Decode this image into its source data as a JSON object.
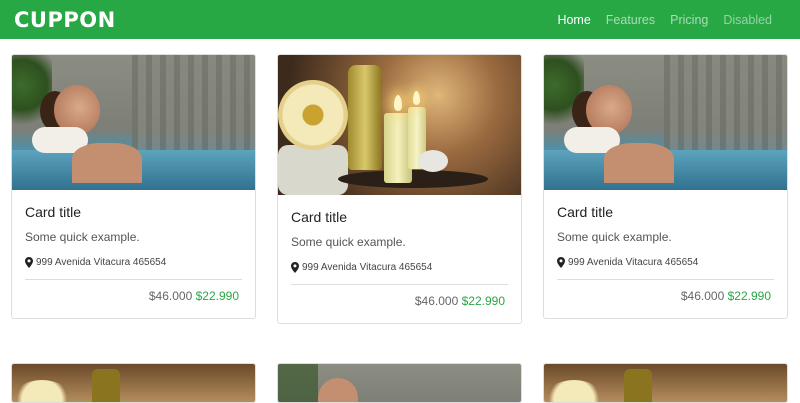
{
  "navbar": {
    "brand": "CUPPON",
    "links": [
      {
        "label": "Home",
        "state": "active"
      },
      {
        "label": "Features",
        "state": "normal"
      },
      {
        "label": "Pricing",
        "state": "normal"
      },
      {
        "label": "Disabled",
        "state": "disabled"
      }
    ]
  },
  "cards": [
    {
      "title": "Card title",
      "text": "Some quick example.",
      "address": "999 Avenida Vitacura 465654",
      "old_price": "$46.000",
      "new_price": "$22.990",
      "image": "spa-pool-woman"
    },
    {
      "title": "Card title",
      "text": "Some quick example.",
      "address": "999 Avenida Vitacura 465654",
      "old_price": "$46.000",
      "new_price": "$22.990",
      "image": "spa-candles"
    },
    {
      "title": "Card title",
      "text": "Some quick example.",
      "address": "999 Avenida Vitacura 465654",
      "old_price": "$46.000",
      "new_price": "$22.990",
      "image": "spa-pool-woman"
    }
  ],
  "row2_images": [
    "spa-candles",
    "spa-pool-woman",
    "spa-candles"
  ],
  "colors": {
    "brand": "#28a745",
    "price_new": "#28a745"
  },
  "icons": {
    "location": "map-marker-icon"
  }
}
